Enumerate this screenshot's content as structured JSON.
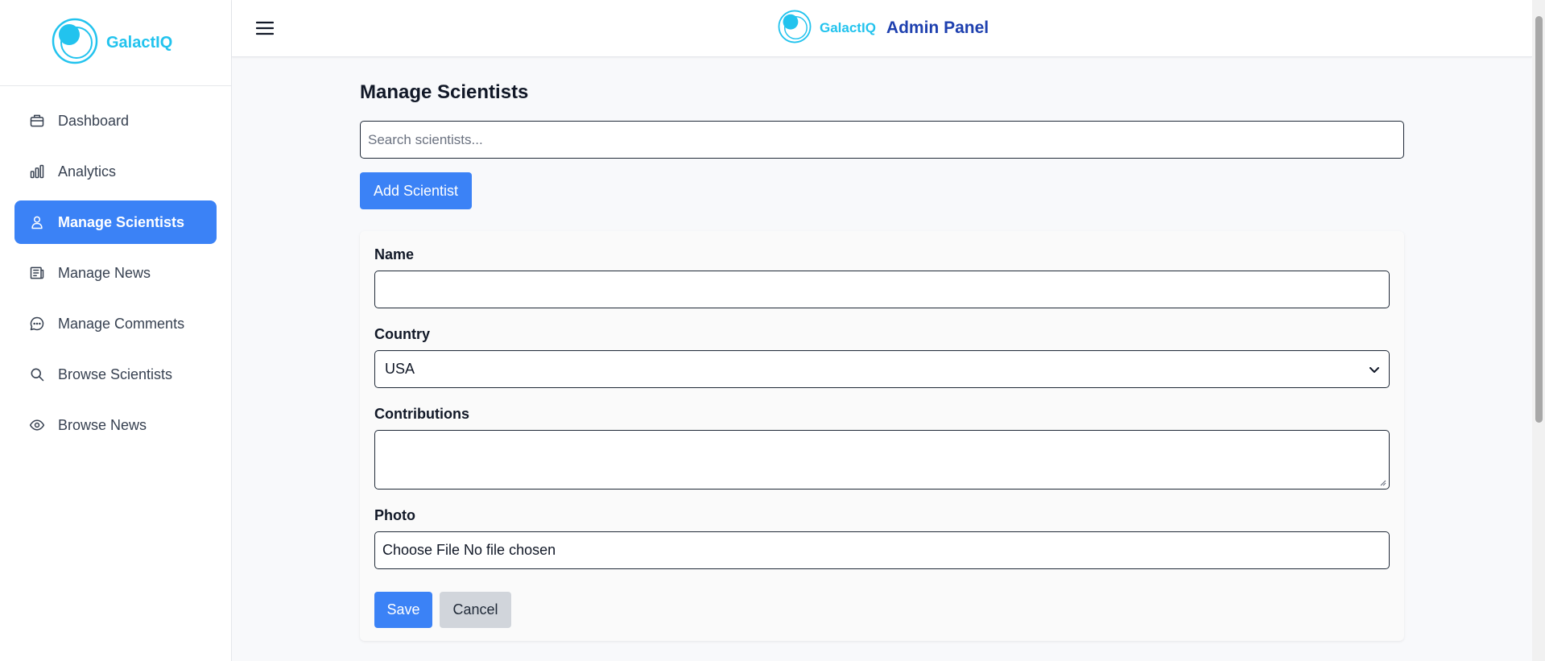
{
  "colors": {
    "accent": "#3b82f6",
    "brand": "#22c3ee",
    "admin_title": "#1e40af",
    "cancel": "#d1d5db"
  },
  "sidebar": {
    "brand": "GalactIQ",
    "items": [
      {
        "label": "Dashboard",
        "icon": "briefcase-icon",
        "active": false
      },
      {
        "label": "Analytics",
        "icon": "bar-chart-icon",
        "active": false
      },
      {
        "label": "Manage Scientists",
        "icon": "user-icon",
        "active": true
      },
      {
        "label": "Manage News",
        "icon": "newspaper-icon",
        "active": false
      },
      {
        "label": "Manage Comments",
        "icon": "chat-bubble-icon",
        "active": false
      },
      {
        "label": "Browse Scientists",
        "icon": "search-icon",
        "active": false
      },
      {
        "label": "Browse News",
        "icon": "eye-icon",
        "active": false
      }
    ]
  },
  "header": {
    "brand": "GalactIQ",
    "title": "Admin Panel"
  },
  "main": {
    "title": "Manage Scientists",
    "search_placeholder": "Search scientists...",
    "search_value": "",
    "add_button": "Add Scientist",
    "form": {
      "name_label": "Name",
      "name_value": "",
      "country_label": "Country",
      "country_value": "USA",
      "contributions_label": "Contributions",
      "contributions_value": "",
      "photo_label": "Photo",
      "file_button": "Choose File",
      "file_status": "No file chosen",
      "save_button": "Save",
      "cancel_button": "Cancel"
    }
  }
}
